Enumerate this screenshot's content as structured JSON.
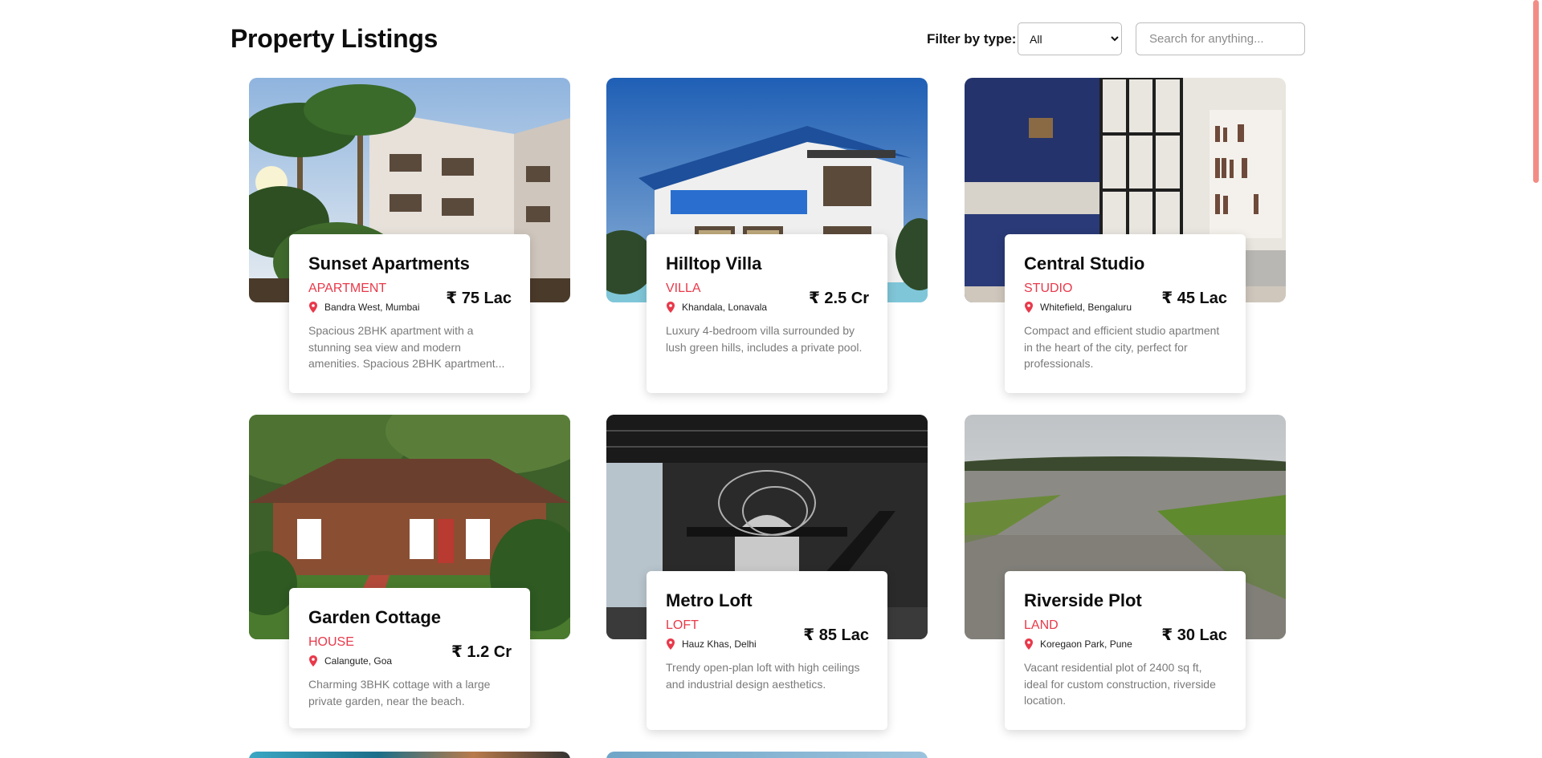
{
  "page_title": "Property Listings",
  "filter": {
    "label": "Filter by type:",
    "selected": "All",
    "options": [
      "All"
    ]
  },
  "search": {
    "placeholder": "Search for anything..."
  },
  "listings": [
    {
      "name": "Sunset Apartments",
      "type": "APARTMENT",
      "location": "Bandra West, Mumbai",
      "price": "₹ 75 Lac",
      "description": "Spacious 2BHK apartment with a stunning sea view and modern amenities. Spacious 2BHK apartment..."
    },
    {
      "name": "Hilltop Villa",
      "type": "VILLA",
      "location": "Khandala, Lonavala",
      "price": "₹ 2.5 Cr",
      "description": "Luxury 4-bedroom villa surrounded by lush green hills, includes a private pool."
    },
    {
      "name": "Central Studio",
      "type": "STUDIO",
      "location": "Whitefield, Bengaluru",
      "price": "₹ 45 Lac",
      "description": "Compact and efficient studio apartment in the heart of the city, perfect for professionals."
    },
    {
      "name": "Garden Cottage",
      "type": "HOUSE",
      "location": "Calangute, Goa",
      "price": "₹ 1.2 Cr",
      "description": "Charming 3BHK cottage with a large private garden, near the beach."
    },
    {
      "name": "Metro Loft",
      "type": "LOFT",
      "location": "Hauz Khas, Delhi",
      "price": "₹ 85 Lac",
      "description": "Trendy open-plan loft with high ceilings and industrial design aesthetics."
    },
    {
      "name": "Riverside Plot",
      "type": "LAND",
      "location": "Koregaon Park, Pune",
      "price": "₹ 30 Lac",
      "description": "Vacant residential plot of 2400 sq ft, ideal for custom construction, riverside location."
    }
  ],
  "colors": {
    "type_accent": "#e8394a",
    "scrollbar": "#f28d86",
    "pin": "#e8394a"
  }
}
